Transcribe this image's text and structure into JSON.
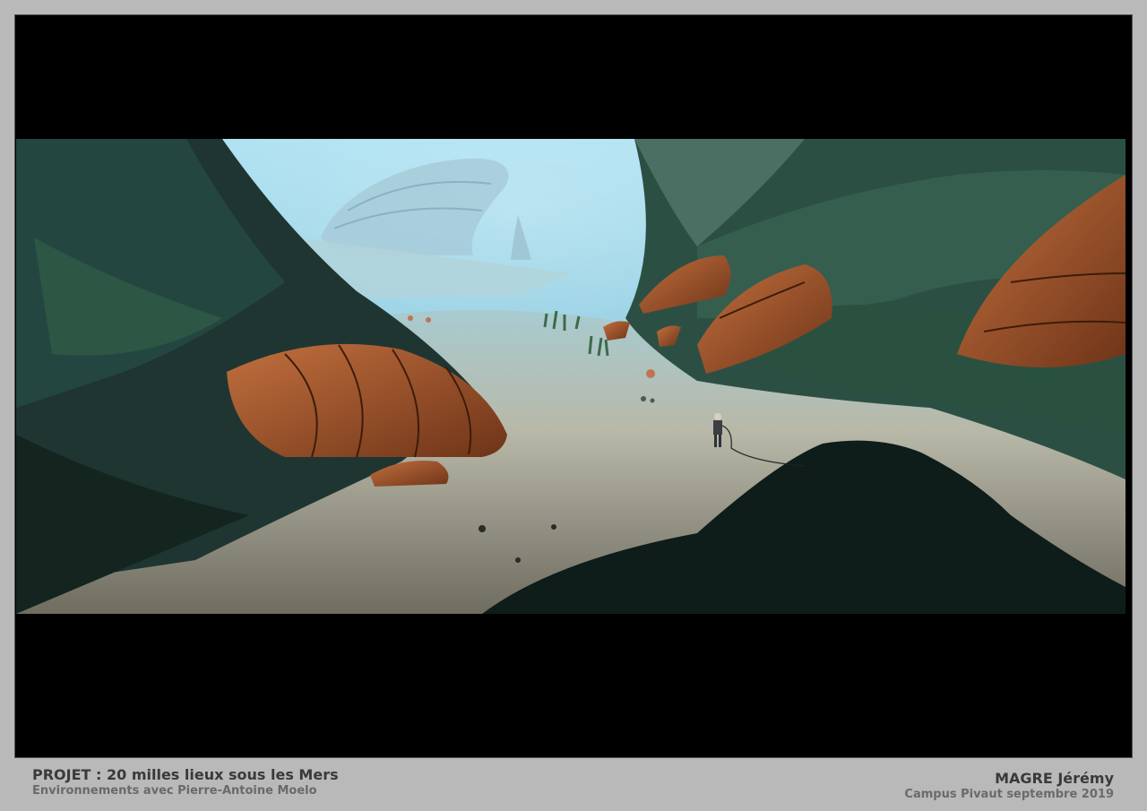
{
  "project": {
    "title": "PROJET : 20 milles lieux sous les Mers",
    "subtitle": "Environnements avec Pierre-Antoine Moelo"
  },
  "author": {
    "name": "MAGRE Jérémy",
    "campus": "Campus Pivaut septembre 2019"
  },
  "colors": {
    "page_background": "#b9b9b9",
    "frame": "#000000",
    "water": "#8fd0e6",
    "sand": "#b9b6a6",
    "rock": "#1e3a35",
    "shell": "#a0542e"
  }
}
